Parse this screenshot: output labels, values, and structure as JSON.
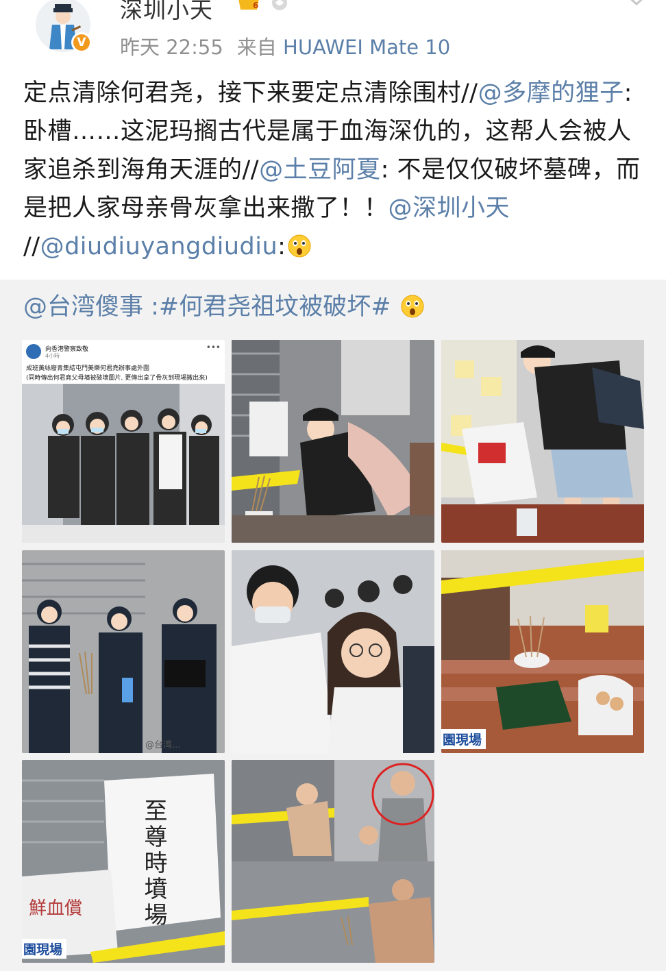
{
  "header": {
    "username": "深圳小天",
    "timestamp": "昨天 22:55",
    "source_prefix": "来自",
    "device": "HUAWEI Mate 10",
    "vip_level": "6",
    "verified_badge": "V"
  },
  "post": {
    "segments": [
      {
        "text": "定点清除何君尧，接下来要定点清除围村//",
        "mention": false
      },
      {
        "text": "@多摩的狸子",
        "mention": true
      },
      {
        "text": ":卧槽……这泥玛搁古代是属于血海深仇的，这帮人会被人家追杀到海角天涯的//",
        "mention": false
      },
      {
        "text": "@土豆阿夏",
        "mention": true
      },
      {
        "text": ": 不是仅仅破坏墓碑，而是把人家母亲骨灰拿出来撒了！！",
        "mention": false
      },
      {
        "text": "@深圳小天",
        "mention": true
      },
      {
        "text": " //",
        "mention": false
      },
      {
        "text": "@diudiuyangdiudiu",
        "mention": true
      },
      {
        "text": ":",
        "mention": false
      }
    ],
    "emoji": "surprised-face-icon"
  },
  "repost": {
    "text": "@台湾傻事 :#何君尧祖坟被破坏# ",
    "emoji": "surprised-face-icon"
  },
  "photos": [
    {
      "name": "news-screenshot",
      "page_name": "向香港警察致敬",
      "time_ago": "4小時",
      "headline": "成班黃絲廢青集結屯門美樂何君堯辦事處外圍",
      "subline": "(同時傳出何君堯父母墳被破壞圖片, 更傳出拿了骨灰到現場撒出來)"
    },
    {
      "name": "woman-placing-incense"
    },
    {
      "name": "woman-with-bag"
    },
    {
      "name": "crowd-with-incense",
      "watermark": "@台湾..."
    },
    {
      "name": "masked-crowd"
    },
    {
      "name": "incense-on-steps",
      "caption": "園現場"
    },
    {
      "name": "handwritten-sign",
      "caption": "園現場",
      "sign_text": "至尊時墳場",
      "note_text": "鮮血償"
    },
    {
      "name": "collage-scene"
    }
  ],
  "colors": {
    "link": "#5b7fa8",
    "repost_bg": "#f2f2f2",
    "caution_tape": "#f4e21a",
    "news_tag": "#1d4d9c"
  }
}
